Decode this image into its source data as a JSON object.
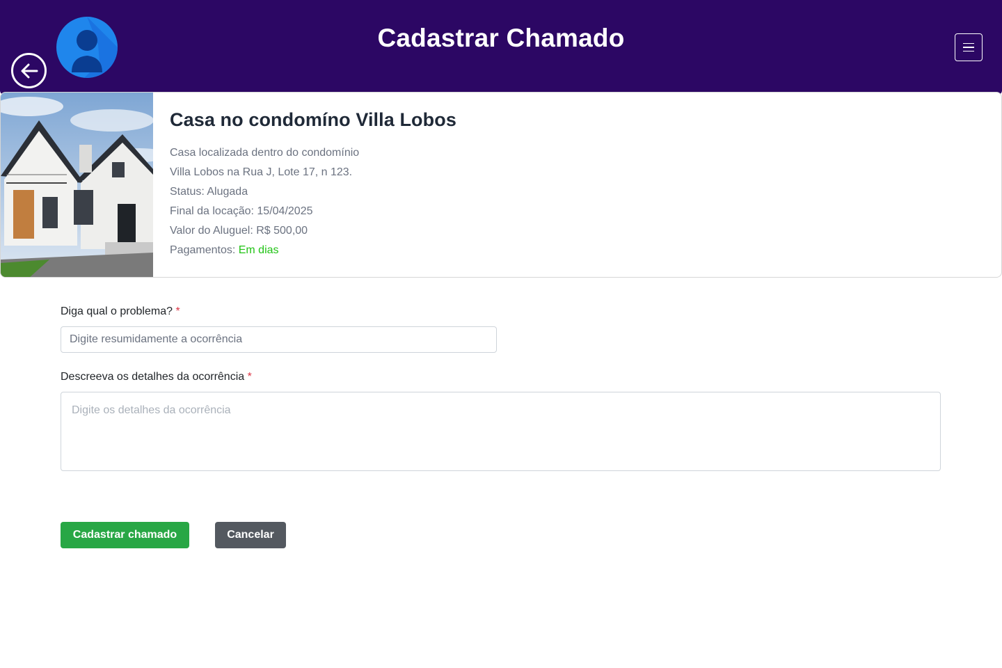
{
  "header": {
    "title": "Cadastrar Chamado",
    "icons": {
      "back": "arrow-left-circle-icon",
      "avatar": "user-avatar-icon",
      "menu": "hamburger-menu-icon"
    },
    "background_color": "#2c0764"
  },
  "property": {
    "title": "Casa no condomíno Villa Lobos",
    "description_line1": "Casa localizada dentro do condomínio",
    "description_line2": "Villa Lobos na Rua J, Lote 17, n 123.",
    "status": "Status: Alugada",
    "lease_end": "Final da locação: 15/04/2025",
    "rent": "Valor do Aluguel: R$ 500,00",
    "payments_label": "Pagamentos:",
    "payments_status": "Em dias",
    "payments_status_color": "#22c316"
  },
  "form": {
    "problem_label": "Diga qual o problema?",
    "problem_placeholder": "Digite resumidamente a ocorrência",
    "problem_value": "",
    "details_label": "Descreeva os detalhes da ocorrência",
    "details_placeholder": "Digite os detalhes da ocorrência",
    "details_value": "",
    "required_mark": "*"
  },
  "actions": {
    "submit_label": "Cadastrar chamado",
    "submit_color": "#28a745",
    "cancel_label": "Cancelar",
    "cancel_color": "#545960"
  }
}
